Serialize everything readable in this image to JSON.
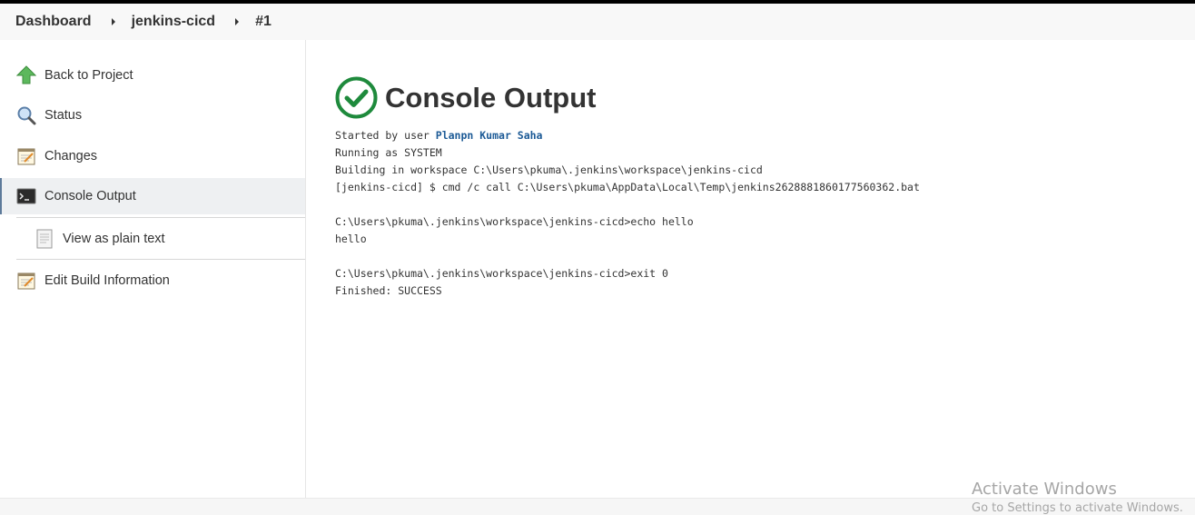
{
  "breadcrumb": {
    "items": [
      "Dashboard",
      "jenkins-cicd",
      "#1"
    ]
  },
  "sidebar": {
    "items": [
      {
        "label": "Back to Project",
        "icon": "up-arrow-icon"
      },
      {
        "label": "Status",
        "icon": "magnifier-icon"
      },
      {
        "label": "Changes",
        "icon": "notepad-icon"
      },
      {
        "label": "Console Output",
        "icon": "terminal-icon",
        "active": true
      },
      {
        "label": "View as plain text",
        "icon": "document-icon"
      },
      {
        "label": "Edit Build Information",
        "icon": "notepad-icon"
      }
    ]
  },
  "main": {
    "title": "Console Output",
    "status_icon": "success-check-icon",
    "started_prefix": "Started by user ",
    "user_name": "Planpn Kumar Saha",
    "lines": [
      "Running as SYSTEM",
      "Building in workspace C:\\Users\\pkuma\\.jenkins\\workspace\\jenkins-cicd",
      "[jenkins-cicd] $ cmd /c call C:\\Users\\pkuma\\AppData\\Local\\Temp\\jenkins2628881860177560362.bat",
      "",
      "C:\\Users\\pkuma\\.jenkins\\workspace\\jenkins-cicd>echo hello",
      "hello",
      "",
      "C:\\Users\\pkuma\\.jenkins\\workspace\\jenkins-cicd>exit 0",
      "Finished: SUCCESS"
    ]
  },
  "watermark": {
    "line1": "Activate Windows",
    "line2": "Go to Settings to activate Windows."
  },
  "colors": {
    "success": "#1e8a3c",
    "link": "#1c5a96",
    "arrow": "#5cb85c"
  }
}
